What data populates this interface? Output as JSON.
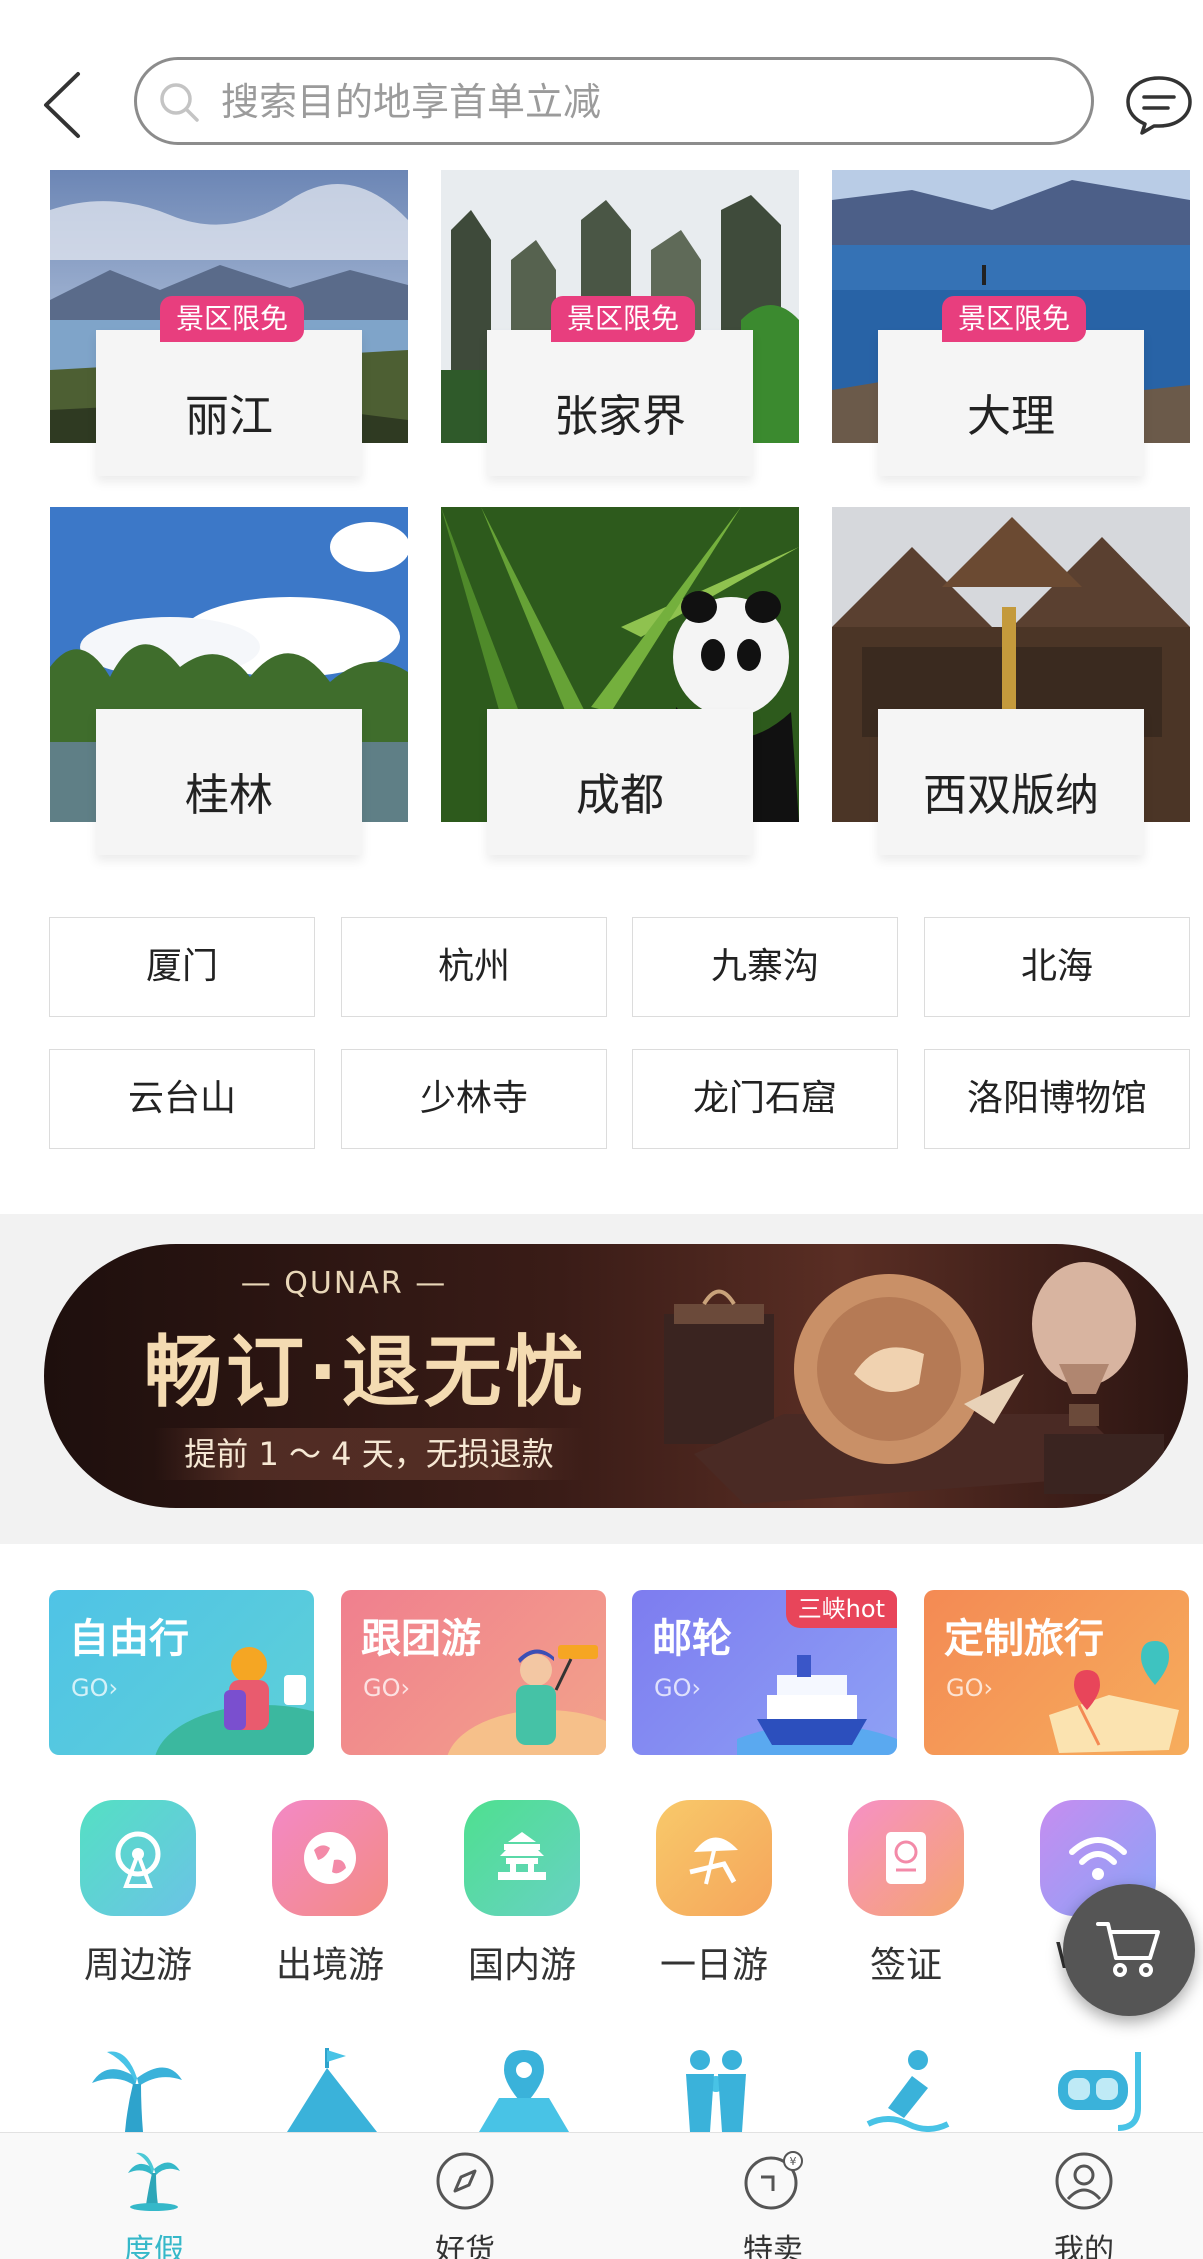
{
  "search": {
    "placeholder": "搜索目的地享首单立减"
  },
  "featured_destinations": [
    {
      "name": "丽江",
      "tag": "景区限免"
    },
    {
      "name": "张家界",
      "tag": "景区限免"
    },
    {
      "name": "大理",
      "tag": "景区限免"
    },
    {
      "name": "桂林",
      "tag": ""
    },
    {
      "name": "成都",
      "tag": ""
    },
    {
      "name": "西双版纳",
      "tag": ""
    }
  ],
  "cities": [
    "厦门",
    "杭州",
    "九寨沟",
    "北海",
    "云台山",
    "少林寺",
    "龙门石窟",
    "洛阳博物馆"
  ],
  "banner": {
    "brand": "— QUNAR —",
    "title": "畅订·退无忧",
    "subtitle": "提前 1 ～ 4 天，无损退款"
  },
  "categories": [
    {
      "title": "自由行",
      "go": "GO›",
      "badge": "",
      "color_from": "#4fc3e6",
      "color_to": "#5ed0d8"
    },
    {
      "title": "跟团游",
      "go": "GO›",
      "badge": "",
      "color_from": "#f07f8e",
      "color_to": "#f3a38a"
    },
    {
      "title": "邮轮",
      "go": "GO›",
      "badge": "三峡hot",
      "color_from": "#7d7cf0",
      "color_to": "#8ea1f5"
    },
    {
      "title": "定制旅行",
      "go": "GO›",
      "badge": "",
      "color_from": "#f48a54",
      "color_to": "#f6ad5c"
    }
  ],
  "round_icons": [
    {
      "label": "周边游",
      "icon": "ferris-wheel-icon"
    },
    {
      "label": "出境游",
      "icon": "globe-icon"
    },
    {
      "label": "国内游",
      "icon": "temple-icon"
    },
    {
      "label": "一日游",
      "icon": "beach-chair-icon"
    },
    {
      "label": "签证",
      "icon": "passport-icon"
    },
    {
      "label": "Wi-Fi",
      "icon": "wifi-icon"
    }
  ],
  "tabbar": [
    {
      "label": "度假",
      "icon": "palm-tree-icon",
      "active": true
    },
    {
      "label": "好货",
      "icon": "compass-icon",
      "active": false
    },
    {
      "label": "特卖",
      "icon": "sale-tag-icon",
      "active": false
    },
    {
      "label": "我的",
      "icon": "user-icon",
      "active": false
    }
  ],
  "colors": {
    "accent": "#35b8c9",
    "tag_pink": "#e83e7e"
  }
}
